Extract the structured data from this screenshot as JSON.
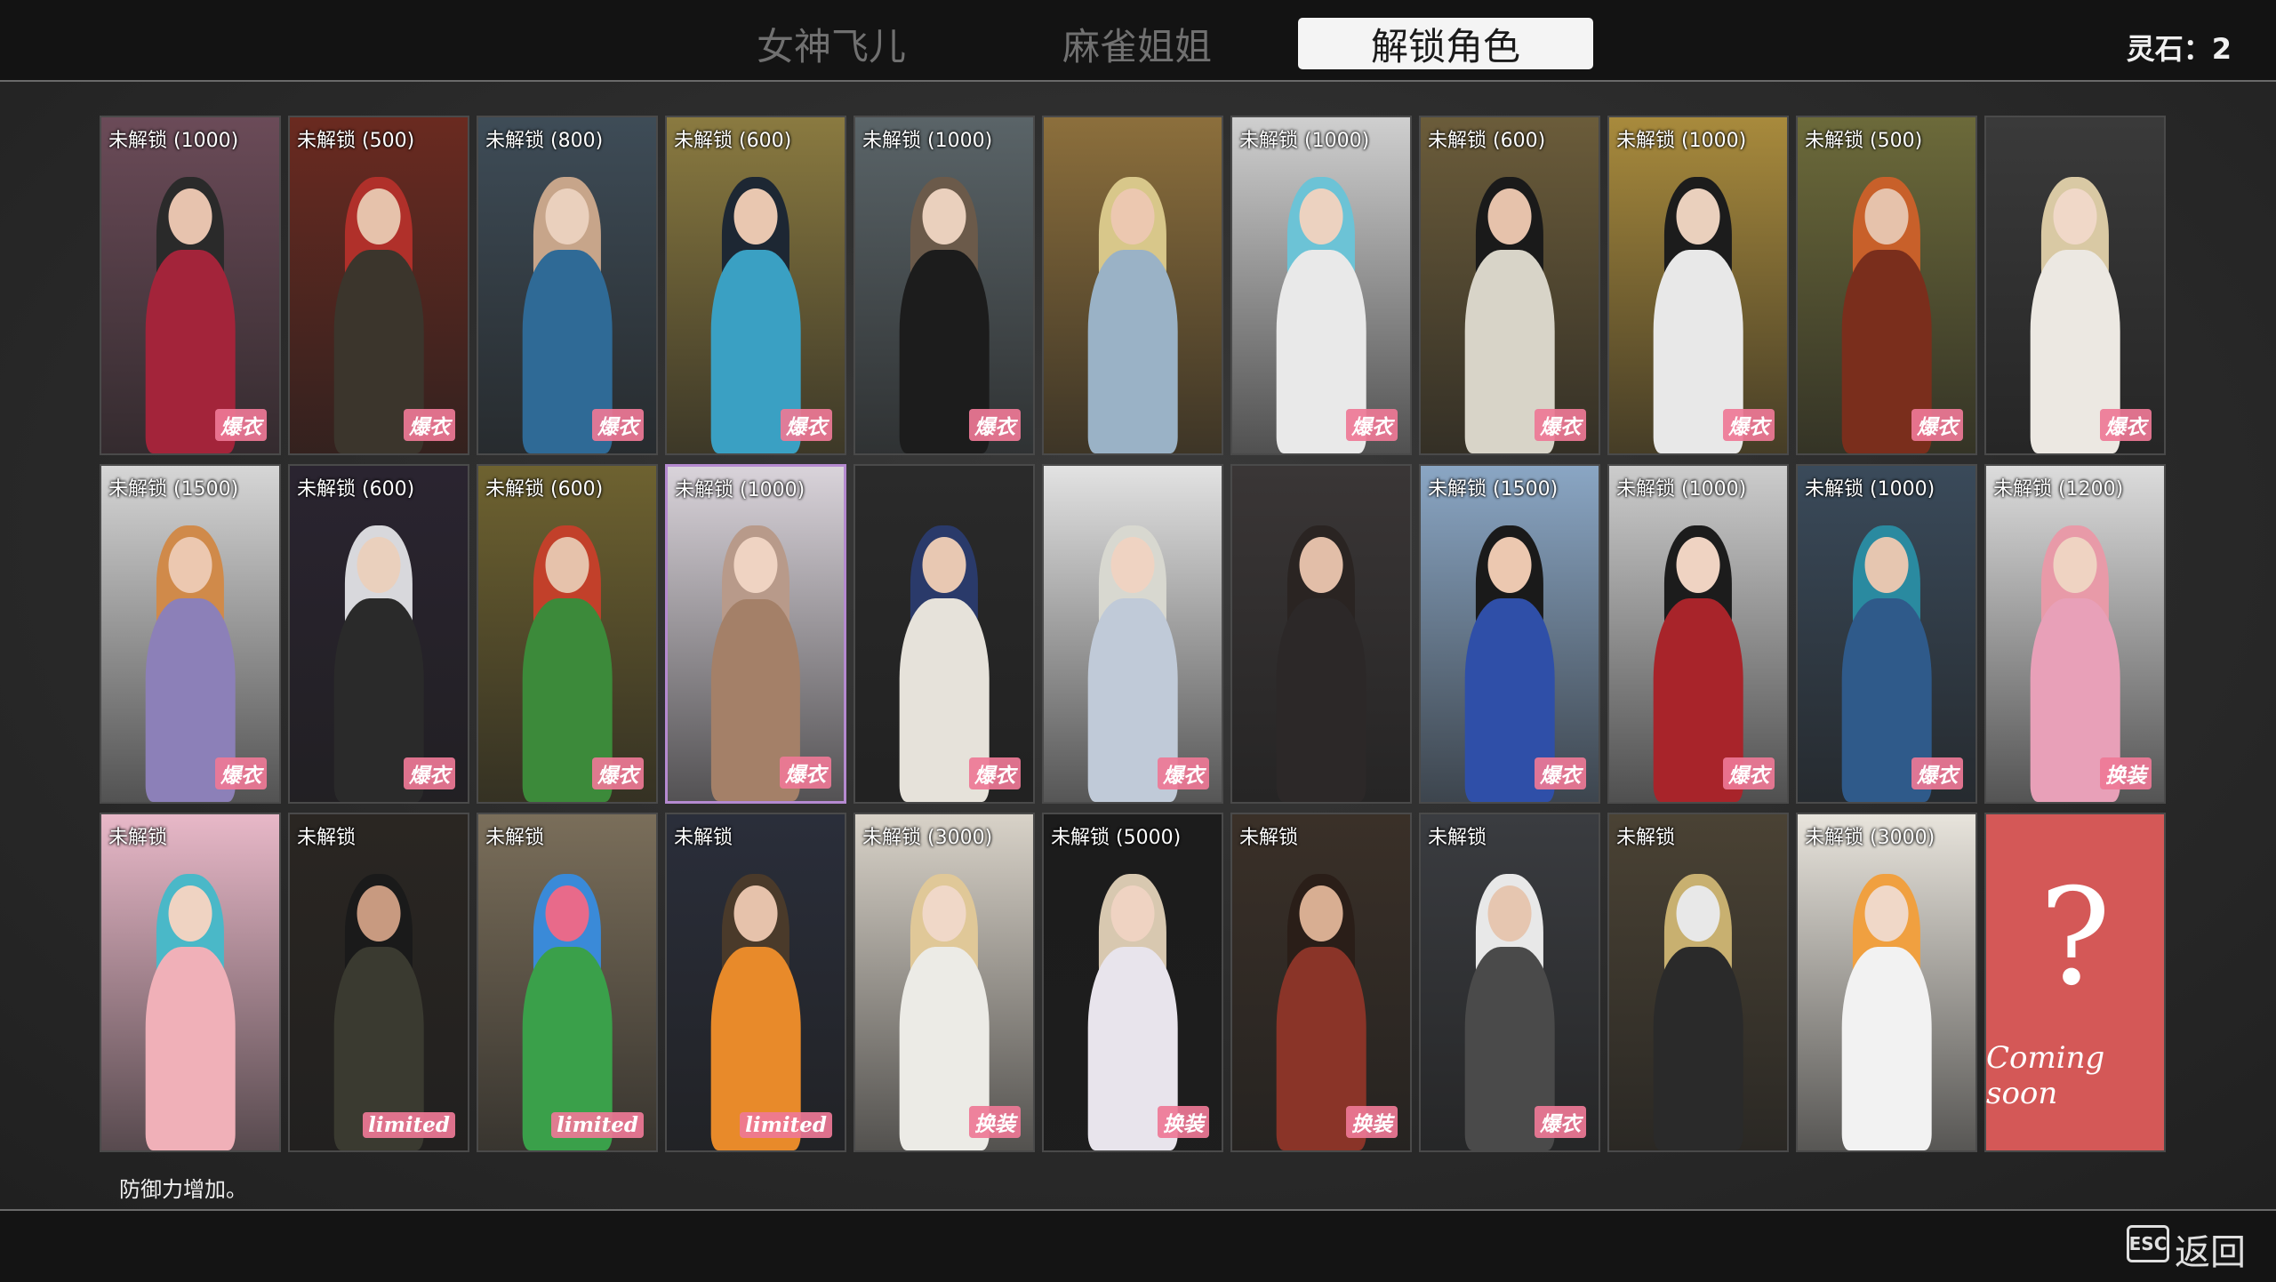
{
  "tabs": [
    {
      "label": "女神飞儿",
      "active": false
    },
    {
      "label": "麻雀姐姐",
      "active": false
    },
    {
      "label": "解锁角色",
      "active": true
    }
  ],
  "currency": "灵石：2",
  "description": "防御力增加。",
  "footer": {
    "esc_label": "ESC",
    "back_label": "返回"
  },
  "colors": {
    "accent_tab_bg": "#f4f4f4",
    "badge_pink": "#ee7896",
    "coming_soon_bg": "#d45857",
    "selected_border": "#b58ad0"
  },
  "cards": [
    {
      "lock": "未解锁 (1000)",
      "badge": "爆衣",
      "bg": "#6b4b58",
      "hair": "#2a2a2a",
      "outfit": "#a3243a",
      "skin": "#e7c3ae"
    },
    {
      "lock": "未解锁 (500)",
      "badge": "爆衣",
      "bg": "#6a2a20",
      "hair": "#b0302a",
      "outfit": "#3b352c",
      "skin": "#e6c2ab"
    },
    {
      "lock": "未解锁 (800)",
      "badge": "爆衣",
      "bg": "#3e4c57",
      "hair": "#c7a58a",
      "outfit": "#2f6a96",
      "skin": "#ead0bd"
    },
    {
      "lock": "未解锁 (600)",
      "badge": "爆衣",
      "bg": "#8a7a40",
      "hair": "#1d2733",
      "outfit": "#3aa0c3",
      "skin": "#e9c7b0"
    },
    {
      "lock": "未解锁 (1000)",
      "badge": "爆衣",
      "bg": "#5a6468",
      "hair": "#6b5a4a",
      "outfit": "#1c1c1c",
      "skin": "#ead0bd"
    },
    {
      "lock": "",
      "badge": "",
      "bg": "#8c6f3c",
      "hair": "#d8c78a",
      "outfit": "#9ab2c6",
      "skin": "#ecc8b0"
    },
    {
      "lock": "未解锁 (1000)",
      "badge": "爆衣",
      "bg": "#cfcfcf",
      "hair": "#6cc3d6",
      "outfit": "#e9e9e9",
      "skin": "#ecd2c0"
    },
    {
      "lock": "未解锁 (600)",
      "badge": "爆衣",
      "bg": "#6b5c3a",
      "hair": "#1a1a1a",
      "outfit": "#d8d4c8",
      "skin": "#e6c2ab"
    },
    {
      "lock": "未解锁 (1000)",
      "badge": "爆衣",
      "bg": "#a88a3c",
      "hair": "#1c1c1c",
      "outfit": "#e8e8e8",
      "skin": "#ead0bd"
    },
    {
      "lock": "未解锁 (500)",
      "badge": "爆衣",
      "bg": "#6c6a3a",
      "hair": "#c8602a",
      "outfit": "#7a2e1c",
      "skin": "#e6c2ab"
    },
    {
      "lock": "",
      "badge": "爆衣",
      "bg": "#3a3a3a",
      "hair": "#d9c9a4",
      "outfit": "#ece8e2",
      "skin": "#f0d8c8"
    },
    {
      "lock": "未解锁 (1500)",
      "badge": "爆衣",
      "bg": "#d6d6d6",
      "hair": "#d08a4a",
      "outfit": "#8c80b8",
      "skin": "#ecc8b0"
    },
    {
      "lock": "未解锁 (600)",
      "badge": "爆衣",
      "bg": "#2a2430",
      "hair": "#d8d8dc",
      "outfit": "#2a2a2a",
      "skin": "#ead0bd"
    },
    {
      "lock": "未解锁 (600)",
      "badge": "爆衣",
      "bg": "#6e6230",
      "hair": "#c2402a",
      "outfit": "#3c8a3a",
      "skin": "#e6c2ab"
    },
    {
      "lock": "未解锁 (1000)",
      "badge": "爆衣",
      "bg": "#d9d3da",
      "hair": "#b89a8a",
      "outfit": "#a48068",
      "skin": "#efd3c2",
      "selected": true
    },
    {
      "lock": "",
      "badge": "爆衣",
      "bg": "#2a2a2a",
      "hair": "#2a3a6a",
      "outfit": "#e6e2da",
      "skin": "#e8c8b2"
    },
    {
      "lock": "",
      "badge": "爆衣",
      "bg": "#e2e2e2",
      "hair": "#d8d8d0",
      "outfit": "#c0cad8",
      "skin": "#efd3c2"
    },
    {
      "lock": "",
      "badge": "",
      "bg": "#3a3636",
      "hair": "#2a2422",
      "outfit": "#2c2828",
      "skin": "#e2bea8"
    },
    {
      "lock": "未解锁 (1500)",
      "badge": "爆衣",
      "bg": "#8aa6c4",
      "hair": "#1a1a1a",
      "outfit": "#2f4fa8",
      "skin": "#ecc8b0"
    },
    {
      "lock": "未解锁 (1000)",
      "badge": "爆衣",
      "bg": "#cccccc",
      "hair": "#1c1c1c",
      "outfit": "#a8242a",
      "skin": "#efd3c2"
    },
    {
      "lock": "未解锁 (1000)",
      "badge": "爆衣",
      "bg": "#3a4a5a",
      "hair": "#2a8aa0",
      "outfit": "#2f5a8a",
      "skin": "#e6c6b0"
    },
    {
      "lock": "未解锁 (1200)",
      "badge": "换装",
      "bg": "#dcdcdc",
      "hair": "#e89aa8",
      "outfit": "#e8a0b8",
      "skin": "#efd3c2"
    },
    {
      "lock": "未解锁",
      "badge": "",
      "bg": "#e8b8c8",
      "hair": "#4ab8c8",
      "outfit": "#f0b0b8",
      "skin": "#efd3c2"
    },
    {
      "lock": "未解锁",
      "badge": "limited",
      "bg": "#2a2622",
      "hair": "#1a1a1a",
      "outfit": "#3a3a30",
      "skin": "#c89a80"
    },
    {
      "lock": "未解锁",
      "badge": "limited",
      "bg": "#7a6e5a",
      "hair": "#3a8ad8",
      "outfit": "#3aa04a",
      "skin": "#e86a8a"
    },
    {
      "lock": "未解锁",
      "badge": "limited",
      "bg": "#2a2e3a",
      "hair": "#4a3a2a",
      "outfit": "#e88a2a",
      "skin": "#e6c2ab"
    },
    {
      "lock": "未解锁 (3000)",
      "badge": "换装",
      "bg": "#d8d2c8",
      "hair": "#e0c898",
      "outfit": "#ecebe6",
      "skin": "#f0d8c8"
    },
    {
      "lock": "未解锁 (5000)",
      "badge": "换装",
      "bg": "#1c1c1c",
      "hair": "#d8c8b0",
      "outfit": "#e8e4ec",
      "skin": "#efd3c2"
    },
    {
      "lock": "未解锁",
      "badge": "换装",
      "bg": "#3a3028",
      "hair": "#2a1e18",
      "outfit": "#8a3428",
      "skin": "#d8ae92"
    },
    {
      "lock": "未解锁",
      "badge": "爆衣",
      "bg": "#3a3c40",
      "hair": "#e8e8e8",
      "outfit": "#4a4a4a",
      "skin": "#e6c6b0"
    },
    {
      "lock": "未解锁",
      "badge": "",
      "bg": "#4a4234",
      "hair": "#c8b070",
      "outfit": "#2a2a2a",
      "skin": "#e8e8e8"
    },
    {
      "lock": "未解锁 (3000)",
      "badge": "",
      "bg": "#e8e4dc",
      "hair": "#f0a040",
      "outfit": "#f2f2f2",
      "skin": "#f0d8c8"
    }
  ],
  "coming_soon": {
    "symbol": "?",
    "label": "Coming soon"
  }
}
